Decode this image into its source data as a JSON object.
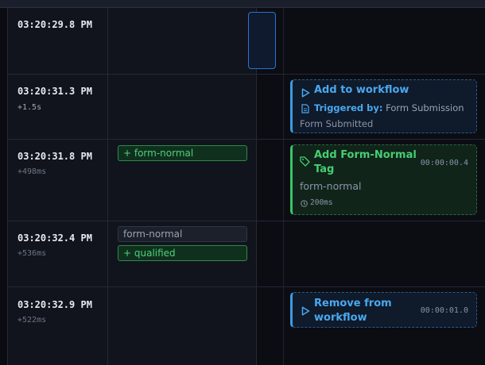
{
  "rows": [
    {
      "time": "03:20:29.8 PM"
    },
    {
      "time": "03:20:31.3 PM",
      "delta": "+1.5s"
    },
    {
      "time": "03:20:31.8 PM",
      "delta": "+498ms"
    },
    {
      "time": "03:20:32.4 PM",
      "delta": "+536ms"
    },
    {
      "time": "03:20:32.9 PM",
      "delta": "+522ms"
    }
  ],
  "tags": {
    "row3_add": "+ form-normal",
    "row4_existing": "form-normal",
    "row4_add": "+ qualified"
  },
  "actions": {
    "add_workflow": {
      "title": "Add to workflow",
      "trigger_label": "Triggered by:",
      "trigger_value": "Form Submission",
      "subtitle": "Form Submitted"
    },
    "add_tag": {
      "title_line1": "Add Form-Normal",
      "title_line2": "Tag",
      "duration": "00:00:00.4",
      "detail": "form-normal",
      "elapsed": "200ms"
    },
    "remove_workflow": {
      "title_line1": "Remove from",
      "title_line2": "workflow",
      "duration": "00:00:01.0"
    }
  },
  "colors": {
    "accent_blue": "#4aa8f0",
    "accent_green": "#45cf72",
    "background": "#0b0d13"
  },
  "icons": {
    "play": "play-icon",
    "document": "document-icon",
    "tag": "tag-icon",
    "clock": "clock-icon"
  }
}
